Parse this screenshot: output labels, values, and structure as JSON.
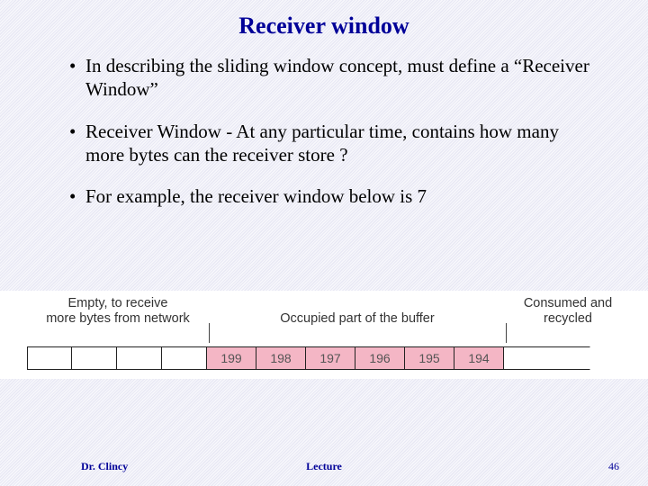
{
  "title": "Receiver window",
  "bullets": [
    "In describing the sliding window concept, must define a “Receiver Window”",
    "Receiver Window - At any particular time, contains how many more bytes can the receiver store ?",
    "For example, the receiver window below is 7"
  ],
  "diagram": {
    "label_left_l1": "Empty, to receive",
    "label_left_l2": "more bytes from network",
    "label_mid": "Occupied part of the buffer",
    "label_right_l1": "Consumed and",
    "label_right_l2": "recycled",
    "empty_cells": 4,
    "occupied_values": [
      "199",
      "198",
      "197",
      "196",
      "195",
      "194"
    ]
  },
  "footer": {
    "author": "Dr. Clincy",
    "lecture": "Lecture",
    "page": "46"
  },
  "chart_data": {
    "type": "table",
    "title": "Receiver buffer state (window size = 7)",
    "segments": [
      {
        "name": "Empty, to receive more bytes from network",
        "cell_count": 4,
        "values": []
      },
      {
        "name": "Occupied part of the buffer",
        "cell_count": 6,
        "values": [
          199,
          198,
          197,
          196,
          195,
          194
        ]
      },
      {
        "name": "Consumed and recycled",
        "cell_count": null,
        "values": []
      }
    ]
  }
}
